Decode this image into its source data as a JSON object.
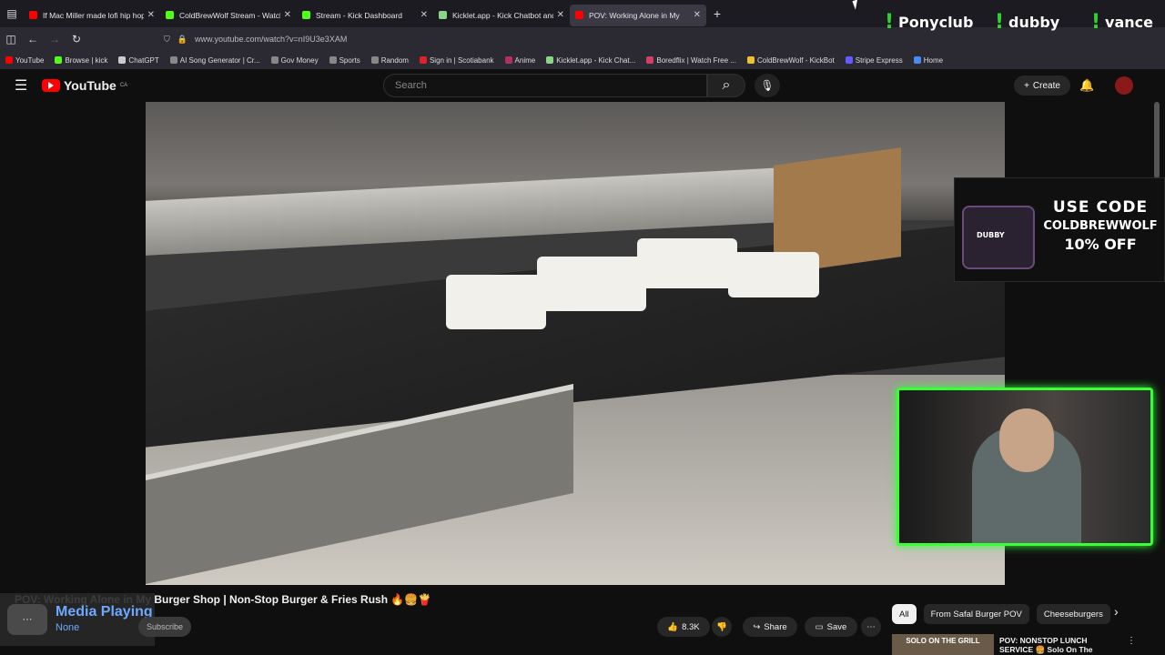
{
  "browser": {
    "tabs": [
      {
        "label": "If Mac Miller made lofi hip hop",
        "color": "#ff0000"
      },
      {
        "label": "ColdBrewWolf Stream - Watch L",
        "color": "#53fc18"
      },
      {
        "label": "Stream - Kick Dashboard",
        "color": "#53fc18"
      },
      {
        "label": "Kicklet.app - Kick Chatbot and C",
        "color": "#8ad58a"
      },
      {
        "label": "POV: Working Alone in My",
        "color": "#ff0000"
      }
    ],
    "url": "www.youtube.com/watch?v=nI9U3e3XAM",
    "bookmarks": [
      {
        "label": "YouTube",
        "color": "#ff0000"
      },
      {
        "label": "Browse | kick",
        "color": "#53fc18"
      },
      {
        "label": "ChatGPT",
        "color": "#cccccc"
      },
      {
        "label": "AI Song Generator | Cr...",
        "color": "#888888"
      },
      {
        "label": "Gov Money",
        "color": "#888888"
      },
      {
        "label": "Sports",
        "color": "#888888"
      },
      {
        "label": "Random",
        "color": "#888888"
      },
      {
        "label": "Sign in | Scotiabank",
        "color": "#e0202b"
      },
      {
        "label": "Anime",
        "color": "#b03060"
      },
      {
        "label": "Kicklet.app - Kick Chat...",
        "color": "#8ad58a"
      },
      {
        "label": "Boredflix | Watch Free ...",
        "color": "#d04060"
      },
      {
        "label": "ColdBrewWolf - KickBot",
        "color": "#f0c030"
      },
      {
        "label": "Stripe Express",
        "color": "#635bff"
      },
      {
        "label": "Home",
        "color": "#4a8af0"
      }
    ]
  },
  "youtube": {
    "logo_text": "YouTube",
    "region": "CA",
    "search_placeholder": "Search",
    "create_label": "Create",
    "video_title": "POV: Working Alone in My Burger Shop | Non-Stop Burger & Fries Rush 🔥🍔🍟",
    "subscribe_label": "Subscribe",
    "like_count": "8.3K",
    "share_label": "Share",
    "save_label": "Save",
    "chips": [
      "All",
      "From Safal Burger POV",
      "Cheeseburgers"
    ],
    "rec_thumb_text": "SOLO ON THE GRILL",
    "rec_title": "POV: NONSTOP LUNCH SERVICE 🍔 Solo On The"
  },
  "overlay": {
    "alerts": [
      "Ponyclub",
      "dubby",
      "vance"
    ],
    "ad": {
      "line1": "USE CODE",
      "line2": "COLDBREWWOLF",
      "line3": "10% OFF",
      "can_label": "DUBBY"
    },
    "media": {
      "title": "Media Playing",
      "status": "None"
    }
  }
}
